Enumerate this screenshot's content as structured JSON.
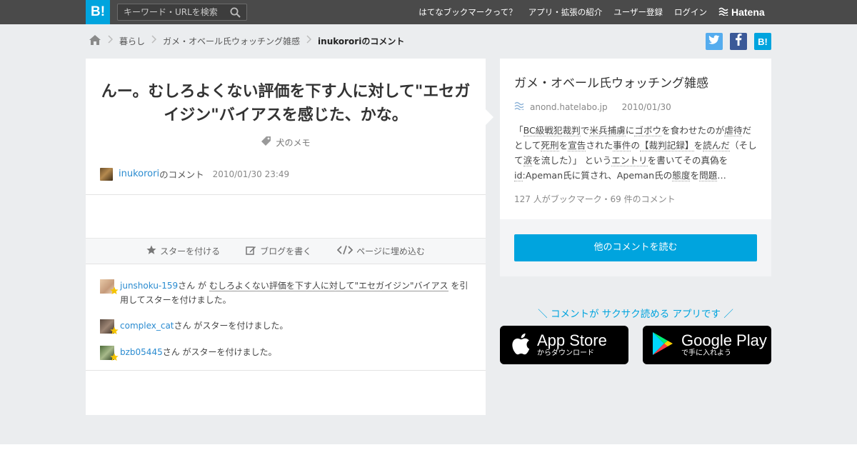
{
  "topbar": {
    "logo": "B!",
    "search_placeholder": "キーワード・URLを検索",
    "nav": [
      "はてなブックマークって？",
      "アプリ・拡張の紹介",
      "ユーザー登録",
      "ログイン"
    ],
    "hatena": "Hatena"
  },
  "breadcrumb": [
    "暮らし",
    "ガメ・オベール氏ウォッチング雑感",
    "inukororiのコメント"
  ],
  "share": {
    "twitter": "t",
    "facebook": "f",
    "hatena": "B!"
  },
  "comment": {
    "text": "んー。むしろよくない評価を下す人に対して\"エセガイジン\"バイアスを感じた、かな。",
    "tag": "犬のメモ",
    "user": "inukorori",
    "user_suffix": "のコメント",
    "date": "2010/01/30 23:49"
  },
  "actions": {
    "star": "スターを付ける",
    "blog": "ブログを書く",
    "embed": "ページに埋め込む"
  },
  "stars": [
    {
      "user": "junshoku-159",
      "mid": "さん が ",
      "quote": "むしろよくない評価を下す人に対して\"エセガイジン\"バイアス",
      "after": " を引用してスターを付けました。"
    },
    {
      "user": "complex_cat",
      "mid": "さん がスターを付けました。"
    },
    {
      "user": "bzb05445",
      "mid": "さん がスターを付けました。"
    }
  ],
  "entry": {
    "title": "ガメ・オベール氏ウォッチング雑感",
    "domain": "anond.hatelabo.jp",
    "date": "2010/01/30",
    "excerpt": [
      {
        "t": "「"
      },
      {
        "t": "BC級戦犯裁判",
        "k": true
      },
      {
        "t": "で"
      },
      {
        "t": "米兵捕虜",
        "k": true
      },
      {
        "t": "に"
      },
      {
        "t": "ゴボウ",
        "k": true
      },
      {
        "t": "を食わせたのが"
      },
      {
        "t": "虐待",
        "k": true
      },
      {
        "t": "だとして"
      },
      {
        "t": "死刑",
        "k": true
      },
      {
        "t": "を"
      },
      {
        "t": "宣告",
        "k": true
      },
      {
        "t": "された"
      },
      {
        "t": "事件",
        "k": true
      },
      {
        "t": "の"
      },
      {
        "t": "【裁判記録】",
        "k": true
      },
      {
        "t": "を"
      },
      {
        "t": "読んだ",
        "k": true
      },
      {
        "t": "（そして"
      },
      {
        "t": "涙",
        "k": true
      },
      {
        "t": "を流した）」 という"
      },
      {
        "t": "エントリ",
        "k": true
      },
      {
        "t": "を書いてその真偽を"
      },
      {
        "t": "id",
        "k": true
      },
      {
        "t": ":Apeman氏に質され、Apeman氏の"
      },
      {
        "t": "態度",
        "k": true
      },
      {
        "t": "を"
      },
      {
        "t": "問題",
        "k": true
      },
      {
        "t": "…"
      }
    ],
    "counts": "127 人がブックマーク・69 件のコメント",
    "read_more": "他のコメントを読む"
  },
  "promo": "＼ コメントが サクサク読める アプリです ／",
  "app_store": {
    "big": "App Store",
    "small": "からダウンロード"
  },
  "google_play": {
    "big": "Google Play",
    "small": "で手に入れよう"
  },
  "colors": {
    "accent": "#00a4de",
    "topbar": "#4a4a4a",
    "link": "#2a8bd0",
    "star": "#f5c400",
    "twitter": "#55acee",
    "facebook": "#3b5998"
  }
}
